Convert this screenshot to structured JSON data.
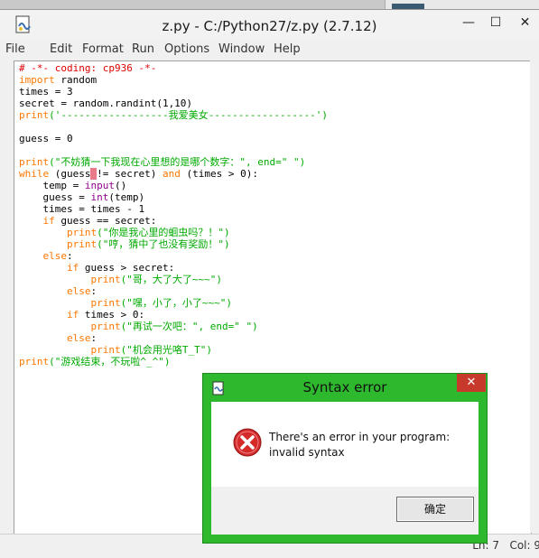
{
  "window": {
    "title": "z.py - C:/Python27/z.py (2.7.12)",
    "controls": {
      "minimize": "—",
      "maximize": "☐",
      "close": "✕"
    }
  },
  "menu": [
    "File",
    "Edit",
    "Format",
    "Run",
    "Options",
    "Window",
    "Help"
  ],
  "code_lines": [
    [
      [
        "cm",
        "# -*- coding: cp936 -*-"
      ]
    ],
    [
      [
        "kw",
        "import"
      ],
      [
        "",
        " random"
      ]
    ],
    [
      [
        "",
        "times = 3"
      ]
    ],
    [
      [
        "",
        "secret = random.randint(1,10)"
      ]
    ],
    [
      [
        "kw",
        "print"
      ],
      [
        "st",
        "('------------------我爱美女------------------')"
      ]
    ],
    [
      [
        "",
        ""
      ]
    ],
    [
      [
        "",
        "guess = 0"
      ]
    ],
    [
      [
        "",
        ""
      ]
    ],
    [
      [
        "kw",
        "print"
      ],
      [
        "st",
        "(\"不妨猜一下我现在心里想的是哪个数字：\", end=\" \")"
      ]
    ],
    [
      [
        "kw",
        "while"
      ],
      [
        "",
        " (guess"
      ],
      [
        "cur",
        " "
      ],
      [
        "",
        "!= secret) "
      ],
      [
        "kw",
        "and"
      ],
      [
        "",
        " (times > 0):"
      ]
    ],
    [
      [
        "",
        "    temp = "
      ],
      [
        "bi",
        "input"
      ],
      [
        "",
        "()"
      ]
    ],
    [
      [
        "",
        "    guess = "
      ],
      [
        "bi",
        "int"
      ],
      [
        "",
        "(temp)"
      ]
    ],
    [
      [
        "",
        "    times = times - 1"
      ]
    ],
    [
      [
        "",
        "    "
      ],
      [
        "kw",
        "if"
      ],
      [
        "",
        " guess == secret:"
      ]
    ],
    [
      [
        "",
        "        "
      ],
      [
        "kw",
        "print"
      ],
      [
        "st",
        "(\"你是我心里的蛔虫吗？！\")"
      ]
    ],
    [
      [
        "",
        "        "
      ],
      [
        "kw",
        "print"
      ],
      [
        "st",
        "(\"哼，猜中了也没有奖励！\")"
      ]
    ],
    [
      [
        "",
        "    "
      ],
      [
        "kw",
        "else"
      ],
      [
        "",
        ":"
      ]
    ],
    [
      [
        "",
        "        "
      ],
      [
        "kw",
        "if"
      ],
      [
        "",
        " guess > secret:"
      ]
    ],
    [
      [
        "",
        "            "
      ],
      [
        "kw",
        "print"
      ],
      [
        "st",
        "(\"哥，大了大了~~~\")"
      ]
    ],
    [
      [
        "",
        "        "
      ],
      [
        "kw",
        "else"
      ],
      [
        "",
        ":"
      ]
    ],
    [
      [
        "",
        "            "
      ],
      [
        "kw",
        "print"
      ],
      [
        "st",
        "(\"嘿，小了，小了~~~\")"
      ]
    ],
    [
      [
        "",
        "        "
      ],
      [
        "kw",
        "if"
      ],
      [
        "",
        " times > 0:"
      ]
    ],
    [
      [
        "",
        "            "
      ],
      [
        "kw",
        "print"
      ],
      [
        "st",
        "(\"再试一次吧：\", end=\" \")"
      ]
    ],
    [
      [
        "",
        "        "
      ],
      [
        "kw",
        "else"
      ],
      [
        "",
        ":"
      ]
    ],
    [
      [
        "",
        "            "
      ],
      [
        "kw",
        "print"
      ],
      [
        "st",
        "(\"机会用光咯T_T\")"
      ]
    ],
    [
      [
        "kw",
        "print"
      ],
      [
        "st",
        "(\"游戏结束，不玩啦^_^\")"
      ]
    ]
  ],
  "status": "Ln: 7   Col: 9",
  "dialog": {
    "title": "Syntax error",
    "close": "✕",
    "message_line1": "There's an error in your program:",
    "message_line2": "invalid syntax",
    "ok_label": "确定"
  },
  "colors": {
    "dialog_border": "#2eb82e",
    "dialog_close": "#c7392b",
    "keyword": "#ff7700",
    "string": "#00aa00",
    "comment": "#dd0000",
    "builtin": "#900090"
  }
}
